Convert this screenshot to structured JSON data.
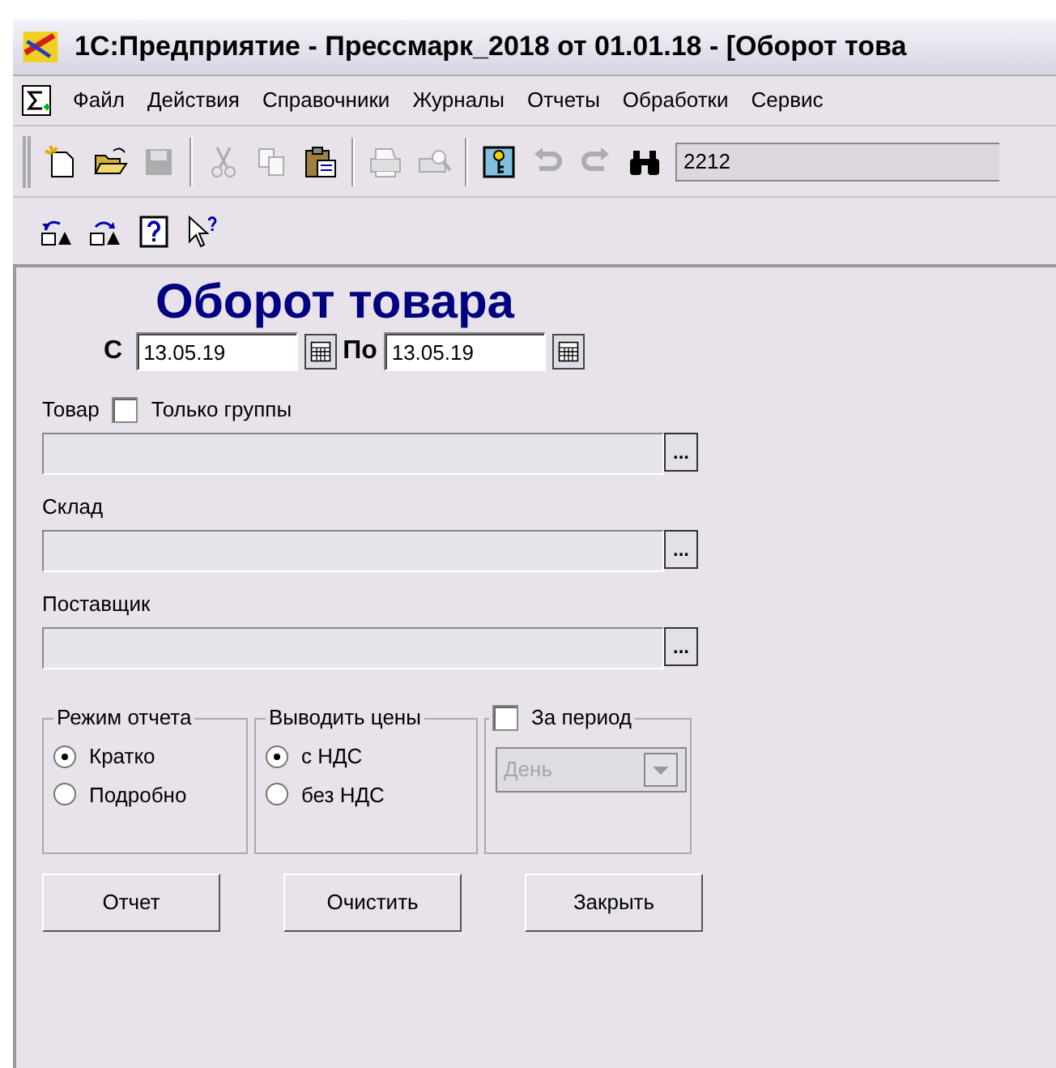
{
  "window": {
    "title": "1С:Предприятие - Прессмарк_2018 от 01.01.18 - [Оборот това"
  },
  "menu": [
    "Файл",
    "Действия",
    "Справочники",
    "Журналы",
    "Отчеты",
    "Обработки",
    "Сервис"
  ],
  "toolbar": {
    "items": [
      {
        "kind": "new",
        "disabled": false
      },
      {
        "kind": "open",
        "disabled": false
      },
      {
        "kind": "save",
        "disabled": true
      },
      {
        "kind": "separator"
      },
      {
        "kind": "cut",
        "disabled": true
      },
      {
        "kind": "copy",
        "disabled": true
      },
      {
        "kind": "paste",
        "disabled": false
      },
      {
        "kind": "separator"
      },
      {
        "kind": "print",
        "disabled": true
      },
      {
        "kind": "preview",
        "disabled": true
      },
      {
        "kind": "separator"
      },
      {
        "kind": "key",
        "disabled": false
      },
      {
        "kind": "undo",
        "disabled": true
      },
      {
        "kind": "redo",
        "disabled": true
      },
      {
        "kind": "find",
        "disabled": false
      }
    ],
    "search_value": "2212"
  },
  "toolbar2": [
    {
      "kind": "lock-up"
    },
    {
      "kind": "lock-down"
    },
    {
      "kind": "help"
    },
    {
      "kind": "context-help"
    }
  ],
  "form": {
    "title": "Оборот товара",
    "period": {
      "from_label": "С",
      "from_value": "13.05.19",
      "to_label": "По",
      "to_value": "13.05.19"
    },
    "fields": [
      {
        "label": "Товар",
        "checkbox": {
          "label": "Только группы",
          "checked": false
        },
        "button": "..."
      },
      {
        "label": "Склад",
        "button": "..."
      },
      {
        "label": "Поставщик",
        "button": "..."
      }
    ],
    "groups": [
      {
        "kind": "radio",
        "title": "Режим отчета",
        "options": [
          {
            "label": "Кратко",
            "selected": true
          },
          {
            "label": "Подробно",
            "selected": false
          }
        ]
      },
      {
        "kind": "radio",
        "title": "Выводить цены",
        "options": [
          {
            "label": "с НДС",
            "selected": true
          },
          {
            "label": "без НДС",
            "selected": false
          }
        ]
      },
      {
        "kind": "check",
        "title": "За период",
        "checked": false,
        "select": {
          "value": "День",
          "disabled": true
        }
      }
    ],
    "buttons": [
      "Отчет",
      "Очистить",
      "Закрыть"
    ]
  }
}
